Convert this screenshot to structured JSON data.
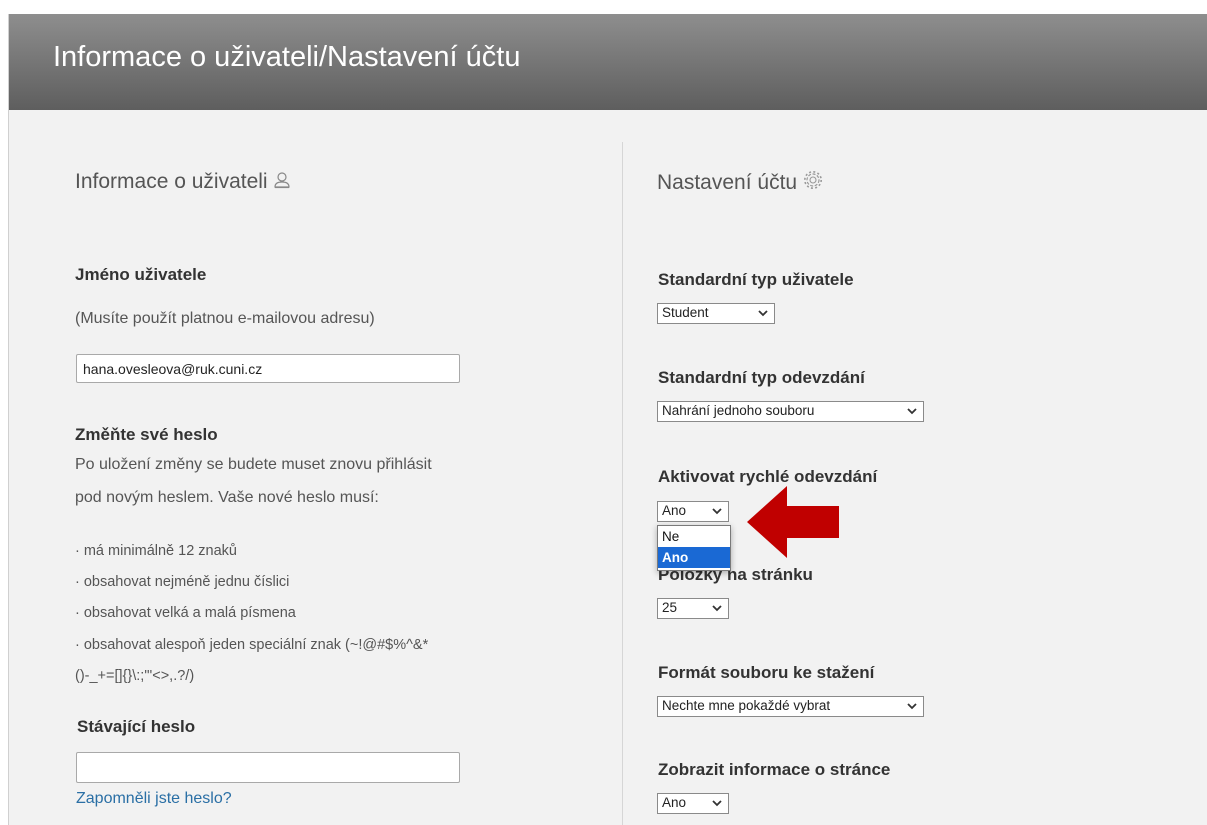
{
  "header": {
    "title": "Informace o uživateli/Nastavení účtu"
  },
  "left": {
    "title": "Informace o uživateli",
    "title_icon": "user-icon",
    "username_label": "Jméno uživatele",
    "username_hint": "(Musíte použít platnou e-mailovou adresu)",
    "username_value": "hana.ovesleova@ruk.cuni.cz",
    "password_heading": "Změňte své heslo",
    "password_text_1": "Po uložení změny se budete muset znovu přihlásit",
    "password_text_2": "pod novým heslem. Vaše nové heslo musí:",
    "rules": [
      "· má minimálně 12 znaků",
      "· obsahovat nejméně jednu číslici",
      "· obsahovat velká a malá písmena",
      "· obsahovat alespoň jeden speciální znak (~!@#$%^&*",
      "()-_+=[]{}\\:;\"'<>,.?/)"
    ],
    "current_password_label": "Stávající heslo",
    "current_password_value": "",
    "forgot_link": "Zapomněli jste heslo?"
  },
  "right": {
    "title": "Nastavení účtu",
    "title_icon": "gear-icon",
    "user_type_label": "Standardní typ uživatele",
    "user_type_value": "Student",
    "submit_type_label": "Standardní typ odevzdání",
    "submit_type_value": "Nahrání jednoho souboru",
    "quick_submit_label": "Aktivovat rychlé odevzdání",
    "quick_submit_value": "Ano",
    "quick_submit_options": [
      "Ne",
      "Ano"
    ],
    "per_page_label": "Položky na stránku",
    "per_page_value": "25",
    "download_format_label": "Formát souboru ke stažení",
    "download_format_value": "Nechte mne pokaždé vybrat",
    "page_info_label": "Zobrazit informace o stránce",
    "page_info_value": "Ano"
  },
  "colors": {
    "header": "#6e6e6e",
    "link": "#2a6fa5",
    "arrow": "#c00000",
    "selected_option": "#1a69d4"
  },
  "annotation": {
    "arrow_icon": "red-arrow-icon"
  }
}
